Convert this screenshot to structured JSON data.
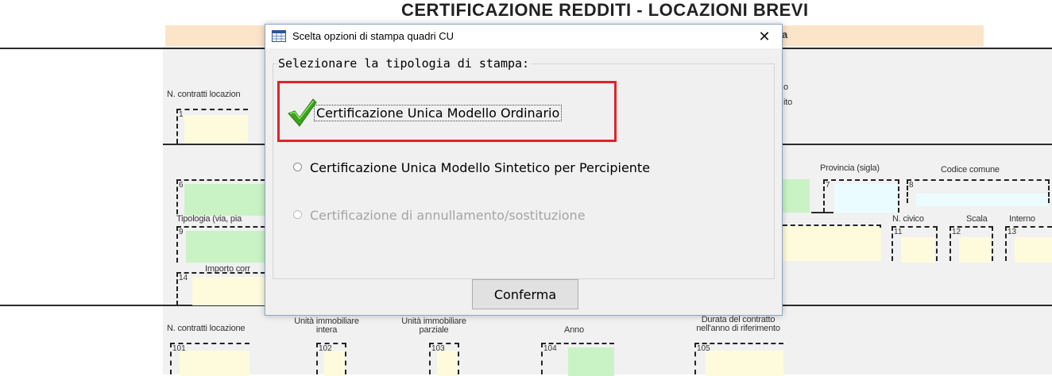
{
  "background_form": {
    "title": "CERTIFICAZIONE REDDITI - LOCAZIONI BREVI",
    "header_fragment_right": "a",
    "label_fragment_right_1": "o",
    "label_fragment_right_2": "ito",
    "row1": {
      "n_contratti_label": "N. contratti locazion",
      "field_1": "1"
    },
    "row2": {
      "field_6": "6",
      "provincia_label": "Provincia (sigla)",
      "field_7": "7",
      "codice_comune_label": "Codice comune",
      "field_8": "8"
    },
    "row3": {
      "tipologia_label": "Tipologia (via, pia",
      "field_9": "9",
      "n_civico_label": "N. civico",
      "field_11": "11",
      "scala_label": "Scala",
      "field_12": "12",
      "interno_label": "Interno",
      "field_13": "13"
    },
    "row4": {
      "importo_label": "Importo corr",
      "field_14": "14"
    },
    "row5": {
      "n_contratti_label": "N. contratti locazione",
      "unita_intera_label_1": "Unità immobiliare",
      "unita_intera_label_2": "intera",
      "unita_parziale_label_1": "Unità immobiliare",
      "unita_parziale_label_2": "parziale",
      "anno_label": "Anno",
      "durata_label_1": "Durata del contratto",
      "durata_label_2": "nell'anno di riferimento",
      "field_101": "101",
      "field_102": "102",
      "field_103": "103",
      "field_104": "104",
      "field_105": "105"
    }
  },
  "dialog": {
    "title": "Scelta opzioni di stampa quadri CU",
    "title_icon": "table-window-icon",
    "close_icon": "close-icon",
    "close_glyph": "✕",
    "group_legend": "Selezionare la tipologia di stampa:",
    "options": [
      {
        "label": "Certificazione Unica Modello Ordinario",
        "selected": true,
        "enabled": true
      },
      {
        "label": "Certificazione Unica Modello Sintetico per Percipiente",
        "selected": false,
        "enabled": true
      },
      {
        "label": "Certificazione di annullamento/sostituzione",
        "selected": false,
        "enabled": false
      }
    ],
    "selected_marker_icon": "green-checkmark-icon",
    "confirm_label": "Conferma"
  },
  "colors": {
    "highlight": "#e0232b",
    "check": "#3aa31a",
    "field_yellow": "#fdfbdc",
    "field_green": "#c9f3c5",
    "field_blue": "#eafcff",
    "band_peach": "#fce4c8"
  }
}
